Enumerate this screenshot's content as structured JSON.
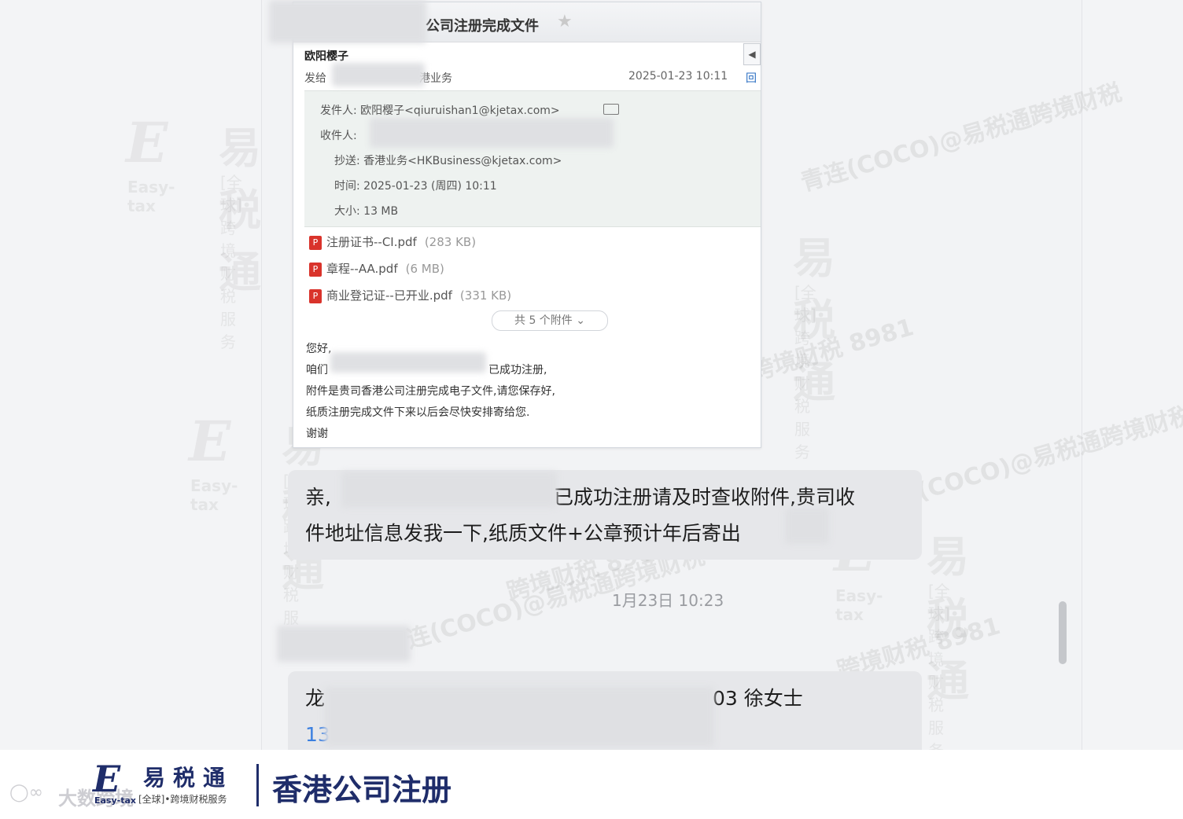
{
  "email": {
    "subject": "公司注册完成文件",
    "sender_name": "欧阳樱子",
    "to_prefix": "发给",
    "to_suffix": "港业务",
    "date": "2025-01-23 10:11",
    "reply_label": "回",
    "from_line": "发件人: 欧阳樱子<qiuruishan1@kjetax.com>",
    "recipient_label": "收件人:",
    "cc_line": "抄送: 香港业务<HKBusiness@kjetax.com>",
    "time_line": "时间: 2025-01-23 (周四) 10:11",
    "size_line": "大小: 13 MB",
    "attachments": [
      {
        "name": "注册证书--CI.pdf",
        "size": "(283 KB)"
      },
      {
        "name": "章程--AA.pdf",
        "size": "(6 MB)"
      },
      {
        "name": "商业登记证--已开业.pdf",
        "size": "(331 KB)"
      }
    ],
    "attach_count": "共 5 个附件 ⌄",
    "body": {
      "greeting": "您好,",
      "line1_start": "咱们",
      "line1_end": "已成功注册,",
      "line2": "附件是贵司香港公司注册完成电子文件,请您保存好,",
      "line3": "纸质注册完成文件下来以后会尽快安排寄给您.",
      "thanks": "谢谢"
    }
  },
  "messages": {
    "msg1_line1_start": "亲,",
    "msg1_line1_end": "已成功注册请及时查收附件,贵司收",
    "msg1_line2": "件地址信息发我一下,纸质文件+公章预计年后寄出",
    "timestamp": "1月23日 10:23",
    "msg2_start": "龙",
    "msg2_end": "03 徐女士",
    "msg2_phone": "13"
  },
  "watermarks": {
    "brand_cn": "易税通",
    "brand_en": "Easy-tax",
    "brand_tag": "[全球]•跨境财税服务",
    "handle": "青连(COCO)@易税通跨境财税",
    "number": "跨境财税 8981"
  },
  "footer": {
    "logo_cn": "易税通",
    "logo_en": "Easy-tax",
    "logo_tag": "[全球]•跨境财税服务",
    "title": "香港公司注册",
    "platform_text": "大数跨境"
  },
  "colors": {
    "brand": "#1f2d6a",
    "pdf_red": "#d9332b",
    "link_blue": "#3b7fe0"
  }
}
